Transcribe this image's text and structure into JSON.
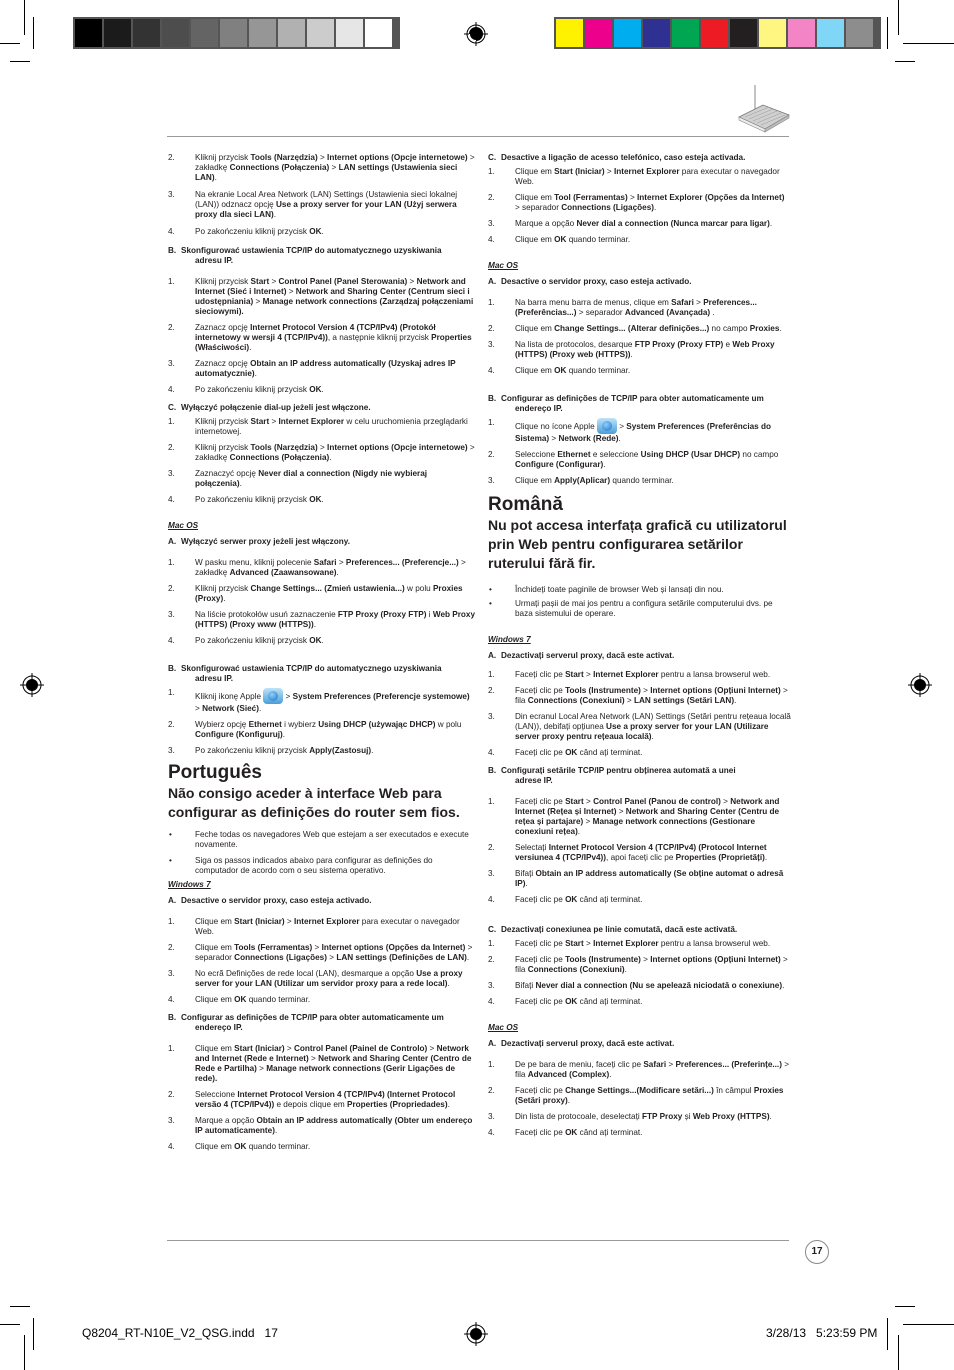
{
  "color_bars": {
    "grayscale": [
      "#000000",
      "#1b1b1b",
      "#333333",
      "#4d4d4d",
      "#646464",
      "#808080",
      "#969696",
      "#b1b1b1",
      "#cccccc",
      "#e6e6e6",
      "#ffffff"
    ],
    "process": [
      "#fff200",
      "#ec008c",
      "#00aeef",
      "#2e3192",
      "#00a651",
      "#ed1c24",
      "#231f20",
      "#fff681",
      "#f384c6",
      "#7fd6f7",
      "#8e8d8d"
    ]
  },
  "icons": {
    "registration_mark": "registration-target-icon",
    "router_illustration": "router-icon",
    "apple_icon": "apple-logo-icon"
  },
  "left_column": {
    "polish_win_a_cont": [
      {
        "n": "2.",
        "html": "Kliknij przycisk <b>Tools (Narzędzia)</b> &gt; <b>Internet options (Opcje internetowe)</b> &gt; zakładkę <b>Connections (Połączenia)</b> &gt; <b>LAN settings (Ustawienia sieci LAN)</b>."
      },
      {
        "n": "3.",
        "html": "Na ekranie Local Area Network (LAN) Settings (Ustawienia sieci lokalnej (LAN)) odznacz opcję <b>Use a proxy server for your LAN (Użyj serwera proxy dla sieci LAN)</b>."
      },
      {
        "n": "4.",
        "html": "Po zakończeniu kliknij przycisk <b>OK</b>."
      }
    ],
    "polish_win_b_title": {
      "letter": "B.",
      "line1": "Skonfigurować ustawienia TCP/IP do automatycznego uzyskiwania",
      "line2": "adresu IP."
    },
    "polish_win_b": [
      {
        "n": "1.",
        "html": "Kliknij przycisk <b>Start</b> &gt; <b>Control Panel (Panel Sterowania)</b> &gt; <b>Network and Internet (Sieć i Internet)</b> &gt; <b>Network and Sharing Center (Centrum sieci i udostępniania)</b> &gt; <b>Manage network connections (Zarządzaj połączeniami sieciowymi).</b>"
      },
      {
        "n": "2.",
        "html": "Zaznacz opcję <b>Internet Protocol Version 4 (TCP/IPv4) (Protokół internetowy w wersji 4 (TCP/IPv4))</b>, a następnie kliknij przycisk <b>Properties (Właściwości)</b>."
      },
      {
        "n": "3.",
        "html": "Zaznacz opcję <b>Obtain an IP address automatically (Uzyskaj adres IP automatycznie)</b>."
      },
      {
        "n": "4.",
        "html": "Po zakończeniu kliknij przycisk <b>OK</b>."
      }
    ],
    "polish_win_c_title": {
      "letter": "C.",
      "line1": "Wyłączyć połączenie dial-up jeżeli jest włączone."
    },
    "polish_win_c": [
      {
        "n": "1.",
        "html": "Kliknij przycisk <b>Start</b> &gt; <b>Internet Explorer</b> w celu uruchomienia przeglądarki internetowej."
      },
      {
        "n": "2.",
        "html": "Kliknij przycisk <b>Tools (Narzędzia)</b> &gt; <b>Internet options (Opcje internetowe)</b> &gt; zakładkę <b>Connections (Połączenia)</b>."
      },
      {
        "n": "3.",
        "html": "Zaznaczyć opcję <b>Never dial a connection (Nigdy nie wybieraj połączenia)</b>."
      },
      {
        "n": "4.",
        "html": "Po zakończeniu kliknij przycisk <b>OK</b>."
      }
    ],
    "polish_mac_label": "Mac OS",
    "polish_mac_a_title": {
      "letter": "A.",
      "line1": "Wyłączyć serwer proxy jeżeli jest włączony."
    },
    "polish_mac_a": [
      {
        "n": "1.",
        "html": "W pasku menu, kliknij polecenie <b>Safari</b> &gt; <b>Preferences... (Preferencje...)</b> &gt; zakładkę <b>Advanced (Zaawansowane)</b>."
      },
      {
        "n": "2.",
        "html": "Kliknij przycisk <b>Change Settings... (Zmień ustawienia...)</b> w polu <b>Proxies (Proxy)</b>."
      },
      {
        "n": "3.",
        "html": "Na liście protokołów usuń zaznaczenie <b>FTP Proxy (Proxy FTP)</b> i <b>Web Proxy (HTTPS) (Proxy www (HTTPS))</b>."
      },
      {
        "n": "4.",
        "html": "Po zakończeniu kliknij przycisk <b>OK</b>."
      }
    ],
    "polish_mac_b_title": {
      "letter": "B.",
      "line1": "Skonfigurować ustawienia TCP/IP do automatycznego uzyskiwania",
      "line2": "adresu IP."
    },
    "polish_mac_b": [
      {
        "n": "1.",
        "html": "Kliknij ikonę Apple <span class=\"apple\" data-name=\"apple-logo-icon\" data-interactable=\"false\"></span> &gt; <b>System Preferences (Preferencje systemowe)</b> &gt; <b>Network (Sieć)</b>."
      },
      {
        "n": "2.",
        "html": "Wybierz opcję <b>Ethernet</b> i wybierz <b>Using DHCP (używając DHCP)</b> w polu <b>Configure (Konfiguruj)</b>."
      },
      {
        "n": "3.",
        "html": "Po zakończeniu kliknij przycisk <b>Apply(Zastosuj)</b>."
      }
    ],
    "pt_lang": "Português",
    "pt_heading": "Não consigo aceder à interface Web para configurar as definições do router sem fios.",
    "pt_bullets": [
      {
        "n": "•",
        "html": "Feche todas os navegadores Web que estejam a ser executados e execute novamente."
      },
      {
        "n": "•",
        "html": "Siga os passos indicados abaixo para configurar as definições do computador de acordo com o seu sistema operativo."
      }
    ],
    "pt_win_label": "Windows 7",
    "pt_win_a_title": {
      "letter": "A.",
      "line1": "Desactive o servidor proxy, caso esteja activado."
    },
    "pt_win_a": [
      {
        "n": "1.",
        "html": "Clique em <b>Start (Iniciar)</b> &gt; <b>Internet Explorer</b> para executar o navegador Web."
      },
      {
        "n": "2.",
        "html": "Clique em <b>Tools (Ferramentas)</b> &gt; <b>Internet options (Opções da Internet)</b> &gt; separador <b>Connections (Ligações)</b> &gt; <b>LAN settings (Definições de LAN)</b>."
      },
      {
        "n": "3.",
        "html": "No ecrã Definições de rede local (LAN), desmarque a opção <b>Use a proxy server for your LAN (Utilizar um servidor proxy para a rede local)</b>."
      },
      {
        "n": "4.",
        "html": "Clique em <b>OK</b> quando terminar."
      }
    ],
    "pt_win_b_title": {
      "letter": "B.",
      "line1": "Configurar as definições de TCP/IP para obter automaticamente um",
      "line2": "endereço IP."
    },
    "pt_win_b": [
      {
        "n": "1.",
        "html": "Clique em <b>Start (Iniciar)</b> &gt; <b>Control Panel (Painel de Controlo)</b> &gt; <b>Network and Internet (Rede e Internet)</b> &gt; <b>Network and Sharing Center (Centro de Rede e Partilha)</b> &gt; <b>Manage network connections (Gerir Ligações de rede).</b>"
      },
      {
        "n": "2.",
        "html": "Seleccione <b>Internet Protocol Version 4 (TCP/IPv4) (Internet Protocol versão 4 (TCP/IPv4))</b> e depois clique em <b>Properties (Propriedades)</b>."
      },
      {
        "n": "3.",
        "html": "Marque a opção <b>Obtain an IP address automatically (Obter um endereço IP automaticamente)</b>."
      },
      {
        "n": "4.",
        "html": "Clique em <b>OK</b> quando terminar."
      }
    ]
  },
  "right_column": {
    "pt_win_c_title": {
      "letter": "C.",
      "line1": "Desactive a ligação de acesso telefónico, caso esteja activada."
    },
    "pt_win_c": [
      {
        "n": "1.",
        "html": "Clique em <b>Start (Iniciar)</b> &gt; <b>Internet Explorer</b> para executar o navegador Web."
      },
      {
        "n": "2.",
        "html": "Clique em <b>Tool (Ferramentas)</b> &gt; <b>Internet Explorer (Opções da Internet)</b> &gt; separador <b>Connections (Ligações)</b>."
      },
      {
        "n": "3.",
        "html": "Marque a opção <b>Never dial a connection (Nunca marcar para ligar)</b>."
      },
      {
        "n": "4.",
        "html": "Clique em <b>OK</b> quando terminar."
      }
    ],
    "pt_mac_label": "Mac OS",
    "pt_mac_a_title": {
      "letter": "A.",
      "line1": "Desactive o servidor proxy, caso esteja activado."
    },
    "pt_mac_a": [
      {
        "n": "1.",
        "html": "Na barra menu barra de menus, clique em <b>Safari</b> &gt; <b>Preferences... (Preferências...)</b> &gt; separador <b>Advanced (Avançada)</b> ."
      },
      {
        "n": "2.",
        "html": "Clique em <b>Change Settings... (Alterar definições...)</b> no campo <b>Proxies</b>."
      },
      {
        "n": "3.",
        "html": "Na lista de protocolos, desarque <b>FTP Proxy (Proxy FTP)</b> e <b>Web Proxy (HTTPS) (Proxy web (HTTPS))</b>."
      },
      {
        "n": "4.",
        "html": "Clique em <b>OK</b> quando terminar."
      }
    ],
    "pt_mac_b_title": {
      "letter": "B.",
      "line1": "Configurar as definições de TCP/IP para obter automaticamente um",
      "line2": "endereço IP."
    },
    "pt_mac_b": [
      {
        "n": "1.",
        "html": "Clique no ícone Apple <span class=\"apple\" data-name=\"apple-logo-icon\" data-interactable=\"false\"></span> &gt; <b>System Preferences (Preferências do Sistema)</b> &gt; <b>Network (Rede)</b>."
      },
      {
        "n": "2.",
        "html": "Seleccione <b>Ethernet</b> e seleccione <b>Using DHCP (Usar DHCP)</b> no campo <b>Configure (Configurar)</b>."
      },
      {
        "n": "3.",
        "html": "Clique em <b>Apply(Aplicar)</b> quando terminar."
      }
    ],
    "ro_lang": "Română",
    "ro_heading": "Nu pot accesa interfața grafică cu utilizatorul prin Web pentru configurarea setărilor ruterului fără fir.",
    "ro_bullets": [
      {
        "n": "•",
        "html": "Închideți toate paginile de browser Web și lansați din nou."
      },
      {
        "n": "•",
        "html": "Urmați pașii de mai jos pentru a configura setările computerului dvs. pe baza sistemului de operare."
      }
    ],
    "ro_win_label": "Windows 7",
    "ro_win_a_title": {
      "letter": "A.",
      "line1": "Dezactivați serverul proxy, dacă este activat."
    },
    "ro_win_a": [
      {
        "n": "1.",
        "html": "Faceți clic pe <b>Start</b> &gt; <b>Internet Explorer</b> pentru a lansa browserul web."
      },
      {
        "n": "2.",
        "html": "Faceți clic pe <b>Tools (Instrumente)</b> &gt; <b>Internet options (Opțiuni Internet)</b> &gt; fila <b>Connections (Conexiuni)</b> &gt; <b>LAN settings (Setări LAN)</b>."
      },
      {
        "n": "3.",
        "html": "Din ecranul Local Area Network (LAN) Settings (Setări pentru rețeaua locală (LAN)), debifați opțiunea <b>Use a proxy server for your LAN (Utilizare server proxy pentru rețeaua locală)</b>."
      },
      {
        "n": "4.",
        "html": "Faceți clic pe <b>OK</b> când ați terminat."
      }
    ],
    "ro_win_b_title": {
      "letter": "B.",
      "line1": "Configurați setările TCP/IP pentru obținerea automată a unei",
      "line2": "adrese IP."
    },
    "ro_win_b": [
      {
        "n": "1.",
        "html": "Faceți clic pe <b>Start</b> &gt; <b>Control Panel (Panou de control)</b> &gt; <b>Network and Internet (Rețea și Internet)</b> &gt; <b>Network and Sharing Center (Centru de rețea și partajare)</b> &gt; <b>Manage network connections (Gestionare conexiuni rețea)</b>."
      },
      {
        "n": "2.",
        "html": "Selectați <b>Internet Protocol Version 4 (TCP/IPv4) (Protocol Internet versiunea 4 (TCP/IPv4))</b>, apoi faceți clic pe <b>Properties (Proprietăți)</b>."
      },
      {
        "n": "3.",
        "html": "Bifați <b>Obtain an IP address automatically (Se obține automat o adresă IP)</b>."
      },
      {
        "n": "4.",
        "html": "Faceți clic pe <b>OK</b> când ați terminat."
      }
    ],
    "ro_win_c_title": {
      "letter": "C.",
      "line1": "Dezactivați conexiunea pe linie comutată, dacă este activată."
    },
    "ro_win_c": [
      {
        "n": "1.",
        "html": "Faceți clic pe <b>Start</b> &gt; <b>Internet Explorer</b> pentru a lansa browserul web."
      },
      {
        "n": "2.",
        "html": "Faceți clic pe <b>Tools (Instrumente)</b> &gt; <b>Internet options (Opțiuni Internet)</b> &gt; fila <b>Connections (Conexiuni)</b>."
      },
      {
        "n": "3.",
        "html": "Bifați <b>Never dial a connection (Nu se apelează niciodată o conexiune)</b>."
      },
      {
        "n": "4.",
        "html": "Faceți clic pe <b>OK</b> când ați terminat."
      }
    ],
    "ro_mac_label": "Mac OS",
    "ro_mac_a_title": {
      "letter": "A.",
      "line1": "Dezactivați serverul proxy, dacă este activat."
    },
    "ro_mac_a": [
      {
        "n": "1.",
        "html": "De pe bara de meniu, faceți clic pe <b>Safari</b> &gt; <b>Preferences... (Preferințe...)</b> &gt; fila <b>Advanced (Complex)</b>."
      },
      {
        "n": "2.",
        "html": "Faceți clic pe <b>Change Settings...(Modificare setări...)</b> în câmpul <b>Proxies (Setări proxy)</b>."
      },
      {
        "n": "3.",
        "html": "Din lista de protocoale, deselectați <b>FTP Proxy</b> și <b>Web Proxy (HTTPS)</b>."
      },
      {
        "n": "4.",
        "html": "Faceți clic pe <b>OK</b> când ați terminat."
      }
    ]
  },
  "footer": {
    "page_number": "17",
    "slug_file": "Q8204_RT-N10E_V2_QSG.indd   17",
    "slug_date": "3/28/13   5:23:59 PM"
  }
}
